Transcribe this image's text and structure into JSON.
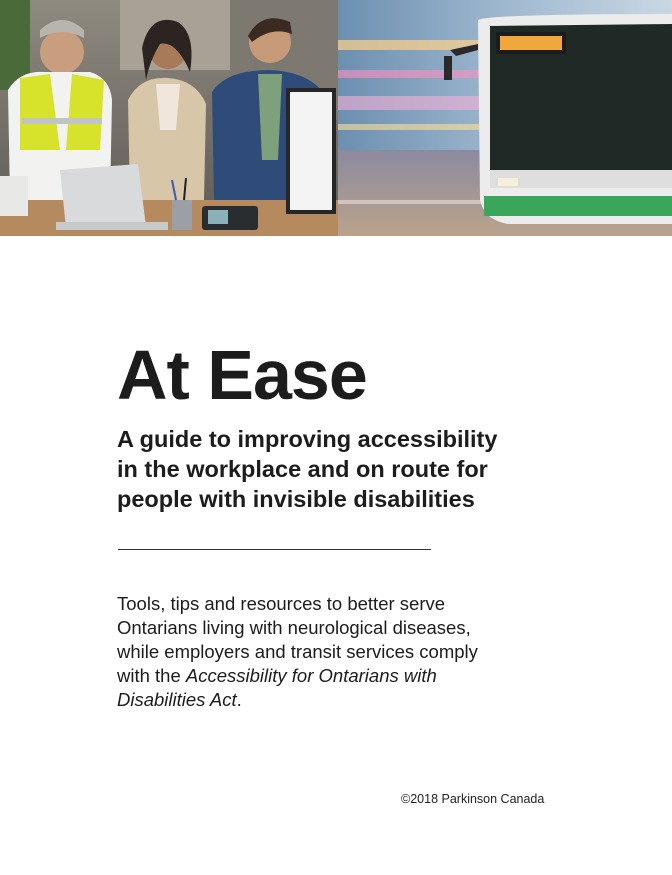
{
  "banner": {
    "left_photo": "office-team-photo",
    "right_photo": "transit-bus-photo"
  },
  "cover": {
    "title": "At Ease",
    "subtitle_lines": [
      "A guide to improving accessibility",
      "in the workplace and on route for",
      "people with invisible disabilities"
    ],
    "intro": {
      "line1": "Tools, tips and resources to better serve",
      "line2": "Ontarians living with neurological diseases,",
      "line3_lead": "while employers and transit services comply",
      "line4_lead": "with the ",
      "line4_italic": "Accessibility for Ontarians with",
      "line5_italic": "Disabilities Act",
      "line5_tail": "."
    },
    "copyright": "©2018 Parkinson Canada"
  },
  "colors": {
    "text": "#1c1c1c",
    "background": "#ffffff",
    "safety_vest": "#d6e32a",
    "bus_green": "#3aa65a"
  }
}
